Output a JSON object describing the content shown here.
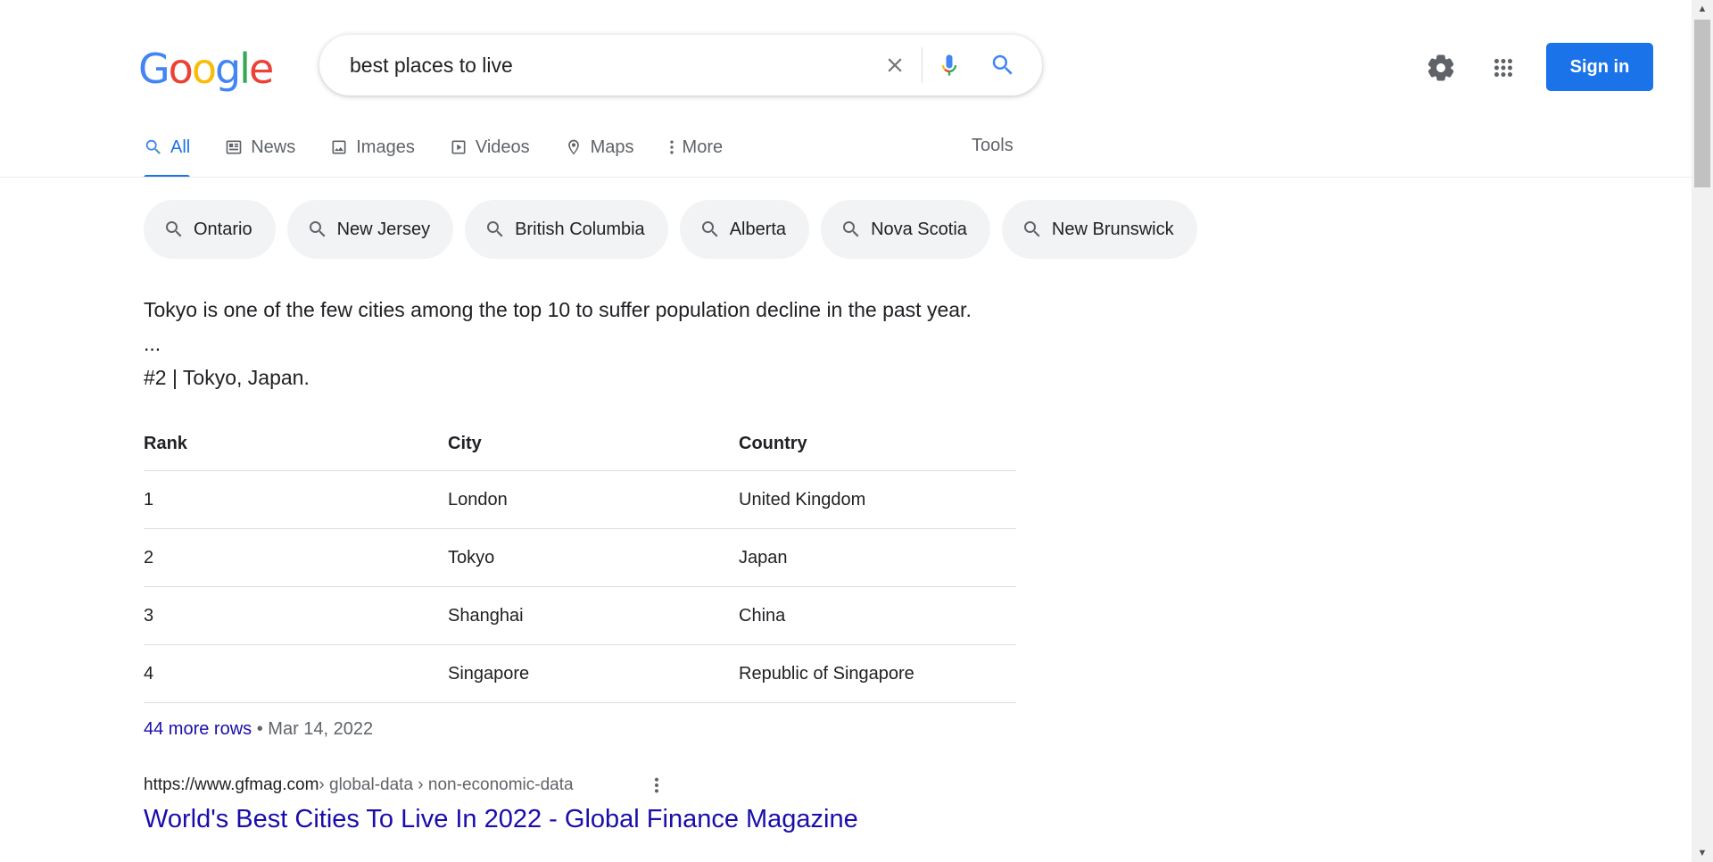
{
  "logo": {
    "text": "Google",
    "letters": [
      {
        "ch": "G",
        "color": "#4285F4"
      },
      {
        "ch": "o",
        "color": "#EA4335"
      },
      {
        "ch": "o",
        "color": "#FBBC05"
      },
      {
        "ch": "g",
        "color": "#4285F4"
      },
      {
        "ch": "l",
        "color": "#34A853"
      },
      {
        "ch": "e",
        "color": "#EA4335"
      }
    ]
  },
  "search": {
    "query": "best places to live"
  },
  "header": {
    "sign_in": "Sign in"
  },
  "tabs": [
    {
      "label": "All",
      "icon": "search-icon",
      "active": true
    },
    {
      "label": "News",
      "icon": "news-icon"
    },
    {
      "label": "Images",
      "icon": "image-icon"
    },
    {
      "label": "Videos",
      "icon": "video-icon"
    },
    {
      "label": "Maps",
      "icon": "map-pin-icon"
    },
    {
      "label": "More",
      "icon": "more-vert-icon"
    }
  ],
  "tools": "Tools",
  "chips": [
    "Ontario",
    "New Jersey",
    "British Columbia",
    "Alberta",
    "Nova Scotia",
    "New Brunswick"
  ],
  "snippet": {
    "line1": "Tokyo is one of the few cities among the top 10 to suffer population decline in the past year.",
    "line2": "...",
    "line3": "#2 | Tokyo, Japan."
  },
  "table": {
    "headers": [
      "Rank",
      "City",
      "Country"
    ],
    "rows": [
      [
        "1",
        "London",
        "United Kingdom"
      ],
      [
        "2",
        "Tokyo",
        "Japan"
      ],
      [
        "3",
        "Shanghai",
        "China"
      ],
      [
        "4",
        "Singapore",
        "Republic of Singapore"
      ]
    ]
  },
  "more_rows": {
    "link": "44 more rows",
    "separator": " • ",
    "date": "Mar 14, 2022"
  },
  "result": {
    "domain": "https://www.gfmag.com",
    "path": " › global-data › non-economic-data",
    "title": "World's Best Cities To Live In 2022 - Global Finance Magazine"
  },
  "colors": {
    "accent": "#1a73e8",
    "link": "#1a0dab",
    "chip_bg": "#f1f3f4"
  }
}
